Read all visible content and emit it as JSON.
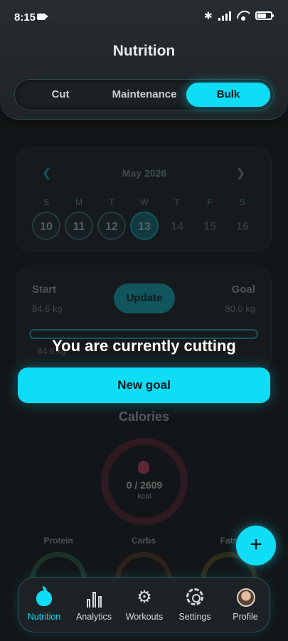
{
  "status_bar": {
    "time": "8:15"
  },
  "header": {
    "title": "Nutrition"
  },
  "segments": {
    "cut": "Cut",
    "maintenance": "Maintenance",
    "bulk": "Bulk",
    "selected": "Bulk"
  },
  "calendar": {
    "month": "May 2026",
    "days": [
      {
        "letter": "S",
        "num": "10",
        "done": true
      },
      {
        "letter": "M",
        "num": "11",
        "done": true
      },
      {
        "letter": "T",
        "num": "12",
        "done": true
      },
      {
        "letter": "W",
        "num": "13",
        "selected": true
      },
      {
        "letter": "T",
        "num": "14"
      },
      {
        "letter": "F",
        "num": "15"
      },
      {
        "letter": "S",
        "num": "16"
      }
    ]
  },
  "goal": {
    "start_label": "Start",
    "start_value": "84.6 kg",
    "goal_label": "Goal",
    "goal_value": "80.0 kg",
    "update_label": "Update",
    "current": "84.6 kg"
  },
  "calories": {
    "title": "Calories",
    "value": "0 / 2609",
    "unit": "kcal"
  },
  "macros": {
    "protein": "Protein",
    "carbs": "Carbs",
    "fats": "Fats"
  },
  "overlay": {
    "message": "You are currently cutting",
    "button": "New goal"
  },
  "fab": {
    "label": "+"
  },
  "nav": {
    "items": [
      {
        "label": "Nutrition",
        "icon": "apple-icon",
        "active": true
      },
      {
        "label": "Analytics",
        "icon": "bar-chart-icon"
      },
      {
        "label": "Workouts",
        "icon": "workout-icon"
      },
      {
        "label": "Settings",
        "icon": "gear-icon"
      },
      {
        "label": "Profile",
        "icon": "avatar"
      }
    ]
  },
  "colors": {
    "accent": "#0fdcf5",
    "background": "#131618",
    "calorie_ring": "#6b2436"
  }
}
